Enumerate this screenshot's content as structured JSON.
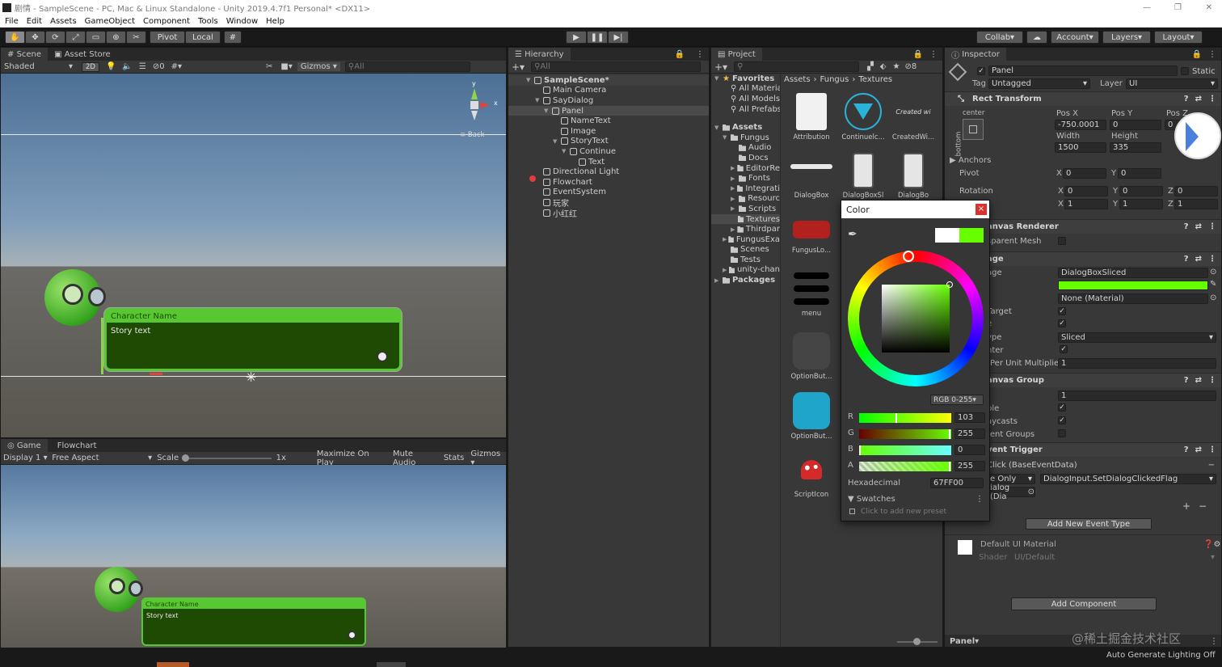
{
  "window": {
    "title": "剧情 - SampleScene - PC, Mac & Linux Standalone - Unity 2019.4.7f1 Personal* <DX11>"
  },
  "menu": [
    "File",
    "Edit",
    "Assets",
    "GameObject",
    "Component",
    "Tools",
    "Window",
    "Help"
  ],
  "toolbar": {
    "pivot": "Pivot",
    "local": "Local",
    "collab": "Collab",
    "account": "Account",
    "layers": "Layers",
    "layout": "Layout"
  },
  "scene": {
    "tabs": [
      "Scene",
      "Asset Store"
    ],
    "shading": "Shaded",
    "mode2d": "2D",
    "hidden_count": "0",
    "gizmos": "Gizmos",
    "search_placeholder": "All",
    "back_label": "Back",
    "axis_y": "y",
    "axis_x": "x"
  },
  "dialog": {
    "name": "Character Name",
    "story": "Story text"
  },
  "game": {
    "tabs": [
      "Game",
      "Flowchart"
    ],
    "display": "Display 1",
    "aspect": "Free Aspect",
    "scale_label": "Scale",
    "scale_value": "1x",
    "maximize": "Maximize On Play",
    "mute": "Mute Audio",
    "stats": "Stats",
    "gizmos": "Gizmos"
  },
  "hierarchy": {
    "tab": "Hierarchy",
    "search_placeholder": "All",
    "items": [
      {
        "label": "SampleScene*",
        "depth": 0,
        "kind": "scene",
        "arrow": "▼"
      },
      {
        "label": "Main Camera",
        "depth": 1,
        "kind": "obj",
        "arrow": ""
      },
      {
        "label": "SayDialog",
        "depth": 1,
        "kind": "obj",
        "arrow": "▼"
      },
      {
        "label": "Panel",
        "depth": 2,
        "kind": "obj",
        "arrow": "▼",
        "selected": true
      },
      {
        "label": "NameText",
        "depth": 3,
        "kind": "obj",
        "arrow": ""
      },
      {
        "label": "Image",
        "depth": 3,
        "kind": "obj",
        "arrow": ""
      },
      {
        "label": "StoryText",
        "depth": 3,
        "kind": "obj",
        "arrow": "▼"
      },
      {
        "label": "Continue",
        "depth": 4,
        "kind": "obj",
        "arrow": "▼"
      },
      {
        "label": "Text",
        "depth": 5,
        "kind": "obj",
        "arrow": ""
      },
      {
        "label": "Directional Light",
        "depth": 1,
        "kind": "obj",
        "arrow": ""
      },
      {
        "label": "Flowchart",
        "depth": 1,
        "kind": "obj",
        "arrow": ""
      },
      {
        "label": "EventSystem",
        "depth": 1,
        "kind": "obj",
        "arrow": ""
      },
      {
        "label": "玩家",
        "depth": 1,
        "kind": "obj",
        "arrow": ""
      },
      {
        "label": "小红红",
        "depth": 1,
        "kind": "obj",
        "arrow": ""
      }
    ]
  },
  "project": {
    "tab": "Project",
    "count": "8",
    "breadcrumb": [
      "Assets",
      "Fungus",
      "Textures"
    ],
    "favorites": {
      "label": "Favorites",
      "items": [
        "All Materia",
        "All Models",
        "All Prefabs"
      ]
    },
    "tree": [
      {
        "label": "Assets",
        "depth": 0,
        "arrow": "▼",
        "bold": true
      },
      {
        "label": "Fungus",
        "depth": 1,
        "arrow": "▼"
      },
      {
        "label": "Audio",
        "depth": 2,
        "arrow": ""
      },
      {
        "label": "Docs",
        "depth": 2,
        "arrow": ""
      },
      {
        "label": "EditorRe",
        "depth": 2,
        "arrow": "▶"
      },
      {
        "label": "Fonts",
        "depth": 2,
        "arrow": "▶"
      },
      {
        "label": "Integrati",
        "depth": 2,
        "arrow": "▶"
      },
      {
        "label": "Resourc",
        "depth": 2,
        "arrow": "▶"
      },
      {
        "label": "Scripts",
        "depth": 2,
        "arrow": "▶"
      },
      {
        "label": "Textures",
        "depth": 2,
        "arrow": "",
        "selected": true
      },
      {
        "label": "Thirdpar",
        "depth": 2,
        "arrow": "▶"
      },
      {
        "label": "FungusExa",
        "depth": 1,
        "arrow": "▶"
      },
      {
        "label": "Scenes",
        "depth": 1,
        "arrow": ""
      },
      {
        "label": "Tests",
        "depth": 1,
        "arrow": ""
      },
      {
        "label": "unity-chan",
        "depth": 1,
        "arrow": "▶"
      },
      {
        "label": "Packages",
        "depth": 0,
        "arrow": "▶",
        "bold": true
      }
    ],
    "assets": [
      "Attribution",
      "Continuelc...",
      "CreatedWi...",
      "DialogBox",
      "DialogBoxSl",
      "DialogBo",
      "FungusLo...",
      "menu",
      "OptionBut...",
      "OptionBut...",
      "ScriptIcon"
    ],
    "created_badge": "Created wi"
  },
  "color_picker": {
    "title": "Color",
    "close": "×",
    "mode": "RGB 0-255",
    "r_label": "R",
    "r": "103",
    "g_label": "G",
    "g": "255",
    "b_label": "B",
    "b": "0",
    "a_label": "A",
    "a": "255",
    "hex_label": "Hexadecimal",
    "hex": "67FF00",
    "swatches": "Swatches",
    "add_preset": "Click to add new preset",
    "color": "#67ff00"
  },
  "inspector": {
    "tab": "Inspector",
    "name": "Panel",
    "static": "Static",
    "tag_label": "Tag",
    "tag": "Untagged",
    "layer_label": "Layer",
    "layer": "UI",
    "rect": {
      "title": "Rect Transform",
      "anchor_h": "center",
      "anchor_v": "bottom",
      "posx_label": "Pos X",
      "posx": "-750.0001",
      "posy_label": "Pos Y",
      "posy": "0",
      "posz_label": "Pos Z",
      "posz": "0",
      "width_label": "Width",
      "width": "1500",
      "height_label": "Height",
      "height": "335",
      "anchors": "Anchors",
      "pivot": "Pivot",
      "pivot_x": "0",
      "pivot_y": "0",
      "rotation": "Rotation",
      "rot": [
        "0",
        "0",
        "0"
      ],
      "scale": [
        "1",
        "1",
        "1"
      ],
      "x_label": "X",
      "y_label": "Y",
      "z_label": "Z"
    },
    "canvas_renderer": {
      "title": "anvas Renderer",
      "cull": "sparent Mesh"
    },
    "image": {
      "title": "age",
      "source_label": "age",
      "source": "DialogBoxSliced",
      "material": "None (Material)",
      "raycast": "Target",
      "maskable": "e",
      "type_label": "ype",
      "type": "Sliced",
      "fill_center": "nter",
      "ppu_label": "Per Unit Multiplier",
      "ppu": "1",
      "color": "#67ff00"
    },
    "canvas_group": {
      "title": "anvas Group",
      "alpha": "1",
      "interact": "ble",
      "blocks": "aycasts",
      "ignore": "rent Groups"
    },
    "event_trigger": {
      "title": "vent Trigger",
      "event": "Click (BaseEventData)",
      "runtime": "e Only",
      "function": "DialogInput.SetDialogClickedFlag",
      "target": "ialog (Dia",
      "add_event": "Add New Event Type"
    },
    "material": {
      "title": "Default UI Material",
      "shader_label": "Shader",
      "shader": "UI/Default"
    },
    "add_component": "Add Component",
    "footer": "Panel"
  },
  "status": {
    "lighting": "Auto Generate Lighting Off",
    "watermark": "@稀土掘金技术社区"
  }
}
